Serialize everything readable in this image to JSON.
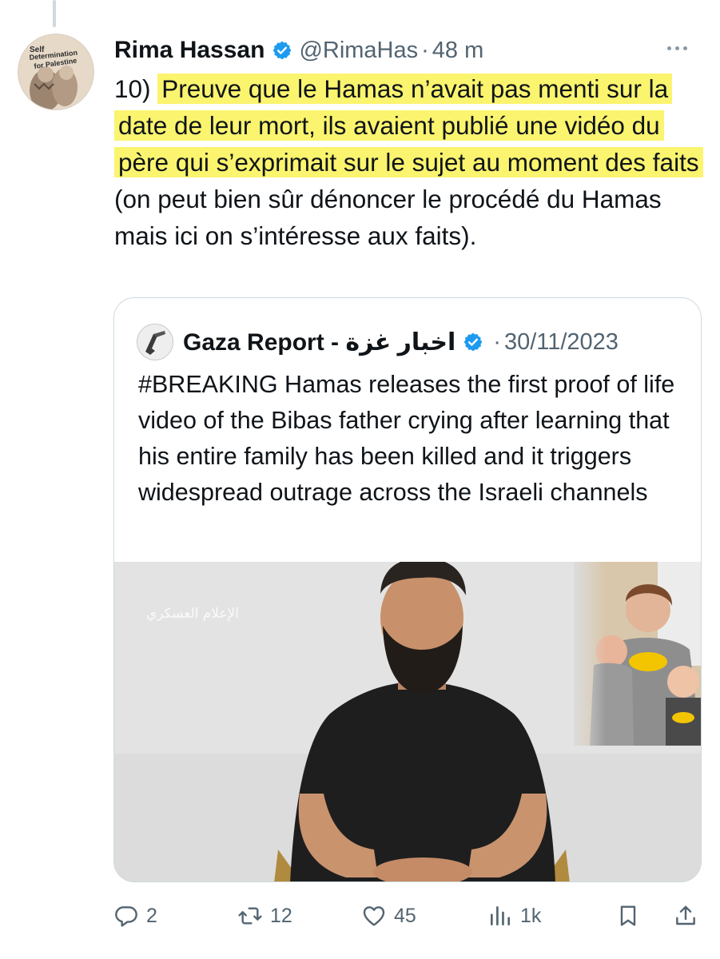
{
  "tweet": {
    "author_name": "Rima Hassan",
    "handle": "@RimaHas",
    "separator": "·",
    "time": "48 m",
    "avatar_text": [
      "Self",
      "Determination",
      "for Palestine"
    ],
    "text": {
      "prefix": "10) ",
      "highlighted": "Preuve que le Hamas n’avait pas menti sur la date de leur mort, ils avaient publié une vidéo du père qui s’exprimait sur le sujet au moment des faits",
      "rest": " (on peut bien sûr dénoncer le procédé du Hamas mais ici on s’intéresse aux faits)."
    },
    "highlight_color": "#fbf46e"
  },
  "quoted_tweet": {
    "author_name": "Gaza Report - اخبار غزة",
    "separator": "·",
    "date": "30/11/2023",
    "text": "#BREAKING Hamas releases the first proof of life video of the Bibas father crying after learning that his entire family has been killed and it triggers widespread outrage across the Israeli channels",
    "media_watermark": "الإعلام العسكري"
  },
  "actions": {
    "reply_count": "2",
    "retweet_count": "12",
    "like_count": "45",
    "views_count": "1k"
  },
  "colors": {
    "verified": "#1d9bf0",
    "secondary_text": "#536471",
    "border": "#cfd9de"
  }
}
